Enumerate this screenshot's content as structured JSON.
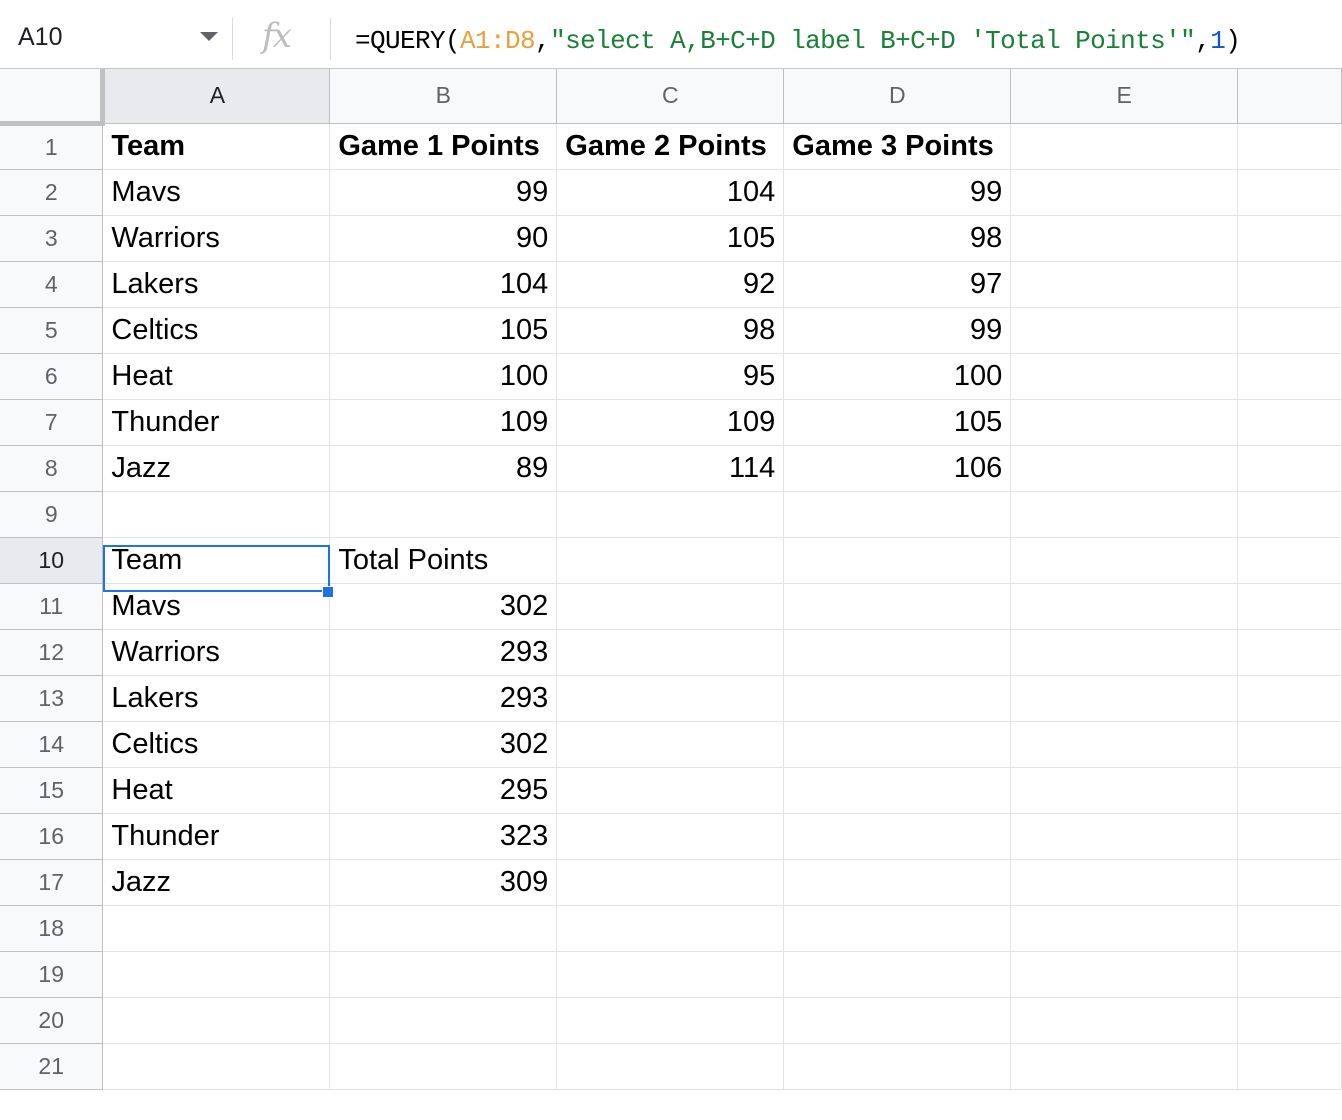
{
  "formula_bar": {
    "cell_ref": "A10",
    "fx_label": "fx",
    "formula_parts": [
      "=QUERY(",
      "A1:D8",
      ",",
      "\"select A,B+C+D label B+C+D 'Total Points'\"",
      ",",
      "1",
      ")"
    ]
  },
  "columns": [
    "A",
    "B",
    "C",
    "D",
    "E"
  ],
  "rows": [
    {
      "n": "1",
      "cells": [
        "Team",
        "Game 1 Points",
        "Game 2 Points",
        "Game 3 Points",
        ""
      ]
    },
    {
      "n": "2",
      "cells": [
        "Mavs",
        "99",
        "104",
        "99",
        ""
      ]
    },
    {
      "n": "3",
      "cells": [
        "Warriors",
        "90",
        "105",
        "98",
        ""
      ]
    },
    {
      "n": "4",
      "cells": [
        "Lakers",
        "104",
        "92",
        "97",
        ""
      ]
    },
    {
      "n": "5",
      "cells": [
        "Celtics",
        "105",
        "98",
        "99",
        ""
      ]
    },
    {
      "n": "6",
      "cells": [
        "Heat",
        "100",
        "95",
        "100",
        ""
      ]
    },
    {
      "n": "7",
      "cells": [
        "Thunder",
        "109",
        "109",
        "105",
        ""
      ]
    },
    {
      "n": "8",
      "cells": [
        "Jazz",
        "89",
        "114",
        "106",
        ""
      ]
    },
    {
      "n": "9",
      "cells": [
        "",
        "",
        "",
        "",
        ""
      ]
    },
    {
      "n": "10",
      "cells": [
        "Team",
        "Total Points",
        "",
        "",
        ""
      ]
    },
    {
      "n": "11",
      "cells": [
        "Mavs",
        "302",
        "",
        "",
        ""
      ]
    },
    {
      "n": "12",
      "cells": [
        "Warriors",
        "293",
        "",
        "",
        ""
      ]
    },
    {
      "n": "13",
      "cells": [
        "Lakers",
        "293",
        "",
        "",
        ""
      ]
    },
    {
      "n": "14",
      "cells": [
        "Celtics",
        "302",
        "",
        "",
        ""
      ]
    },
    {
      "n": "15",
      "cells": [
        "Heat",
        "295",
        "",
        "",
        ""
      ]
    },
    {
      "n": "16",
      "cells": [
        "Thunder",
        "323",
        "",
        "",
        ""
      ]
    },
    {
      "n": "17",
      "cells": [
        "Jazz",
        "309",
        "",
        "",
        ""
      ]
    },
    {
      "n": "18",
      "cells": [
        "",
        "",
        "",
        "",
        ""
      ]
    },
    {
      "n": "19",
      "cells": [
        "",
        "",
        "",
        "",
        ""
      ]
    },
    {
      "n": "20",
      "cells": [
        "",
        "",
        "",
        "",
        ""
      ]
    },
    {
      "n": "21",
      "cells": [
        "",
        "",
        "",
        "",
        ""
      ]
    }
  ],
  "selected_cell": "A10",
  "colors": {
    "selection": "#1a73e8",
    "formula_range": "#e6a13a",
    "formula_string": "#188038",
    "formula_number": "#1155cc"
  }
}
